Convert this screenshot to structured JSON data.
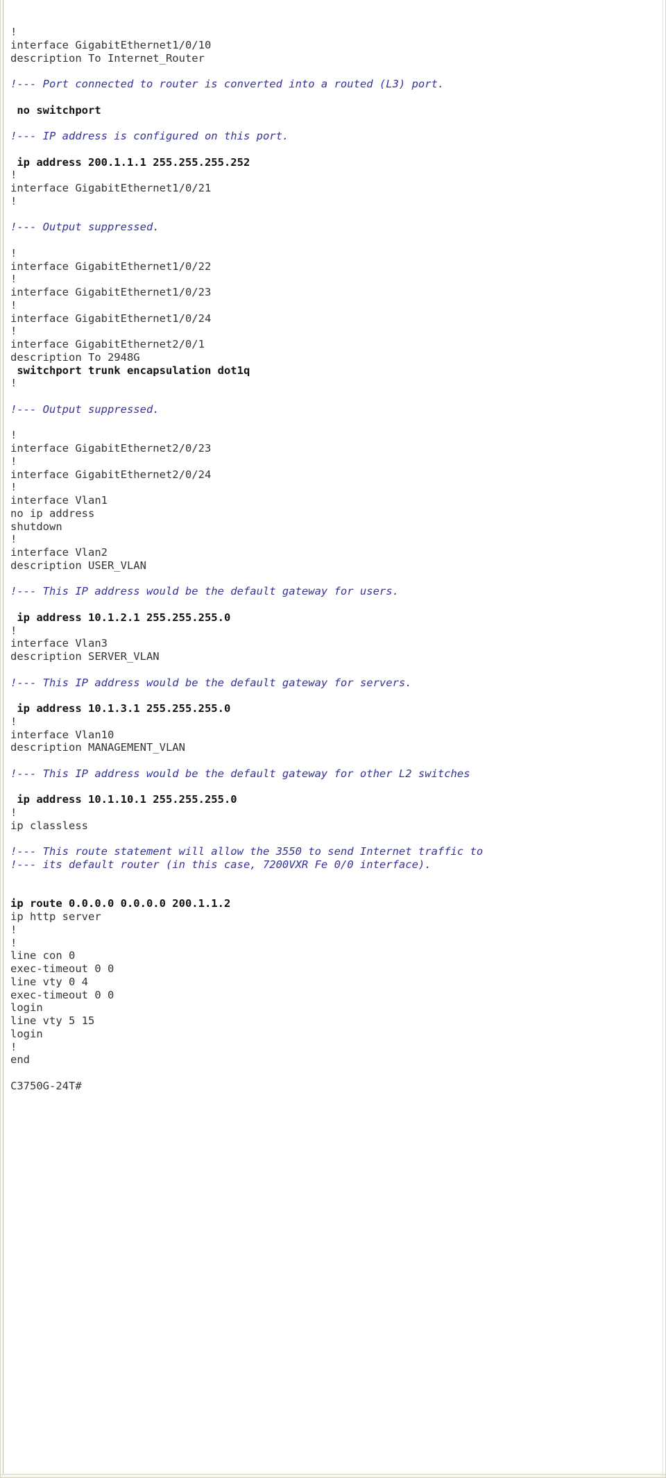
{
  "document": {
    "kind": "cisco-ios-running-config-excerpt",
    "device_prompt": "C3750G-24T#",
    "colors": {
      "plain_text": "#333333",
      "command_text": "#101010",
      "annotation_text": "#333399",
      "page_background": "#ffffff",
      "frame_rule": "#d8d6c8"
    }
  },
  "listing": {
    "lines": [
      {
        "style": "plain",
        "text": "!"
      },
      {
        "style": "plain",
        "text": "interface GigabitEthernet1/0/10"
      },
      {
        "style": "plain",
        "text": "description To Internet_Router"
      },
      {
        "style": "blank",
        "text": ""
      },
      {
        "style": "note",
        "text": "!--- Port connected to router is converted into a routed (L3) port."
      },
      {
        "style": "blank",
        "text": ""
      },
      {
        "style": "cmd",
        "text": " no switchport"
      },
      {
        "style": "blank",
        "text": ""
      },
      {
        "style": "note",
        "text": "!--- IP address is configured on this port."
      },
      {
        "style": "blank",
        "text": ""
      },
      {
        "style": "cmd",
        "text": " ip address 200.1.1.1 255.255.255.252"
      },
      {
        "style": "plain",
        "text": "!"
      },
      {
        "style": "plain",
        "text": "interface GigabitEthernet1/0/21"
      },
      {
        "style": "plain",
        "text": "!"
      },
      {
        "style": "blank",
        "text": ""
      },
      {
        "style": "note",
        "text": "!--- Output suppressed."
      },
      {
        "style": "blank",
        "text": ""
      },
      {
        "style": "plain",
        "text": "!"
      },
      {
        "style": "plain",
        "text": "interface GigabitEthernet1/0/22"
      },
      {
        "style": "plain",
        "text": "!"
      },
      {
        "style": "plain",
        "text": "interface GigabitEthernet1/0/23"
      },
      {
        "style": "plain",
        "text": "!"
      },
      {
        "style": "plain",
        "text": "interface GigabitEthernet1/0/24"
      },
      {
        "style": "plain",
        "text": "!"
      },
      {
        "style": "plain",
        "text": "interface GigabitEthernet2/0/1"
      },
      {
        "style": "plain",
        "text": "description To 2948G"
      },
      {
        "style": "cmd",
        "text": " switchport trunk encapsulation dot1q"
      },
      {
        "style": "plain",
        "text": "!"
      },
      {
        "style": "blank",
        "text": ""
      },
      {
        "style": "note",
        "text": "!--- Output suppressed."
      },
      {
        "style": "blank",
        "text": ""
      },
      {
        "style": "plain",
        "text": "!"
      },
      {
        "style": "plain",
        "text": "interface GigabitEthernet2/0/23"
      },
      {
        "style": "plain",
        "text": "!"
      },
      {
        "style": "plain",
        "text": "interface GigabitEthernet2/0/24"
      },
      {
        "style": "plain",
        "text": "!"
      },
      {
        "style": "plain",
        "text": "interface Vlan1"
      },
      {
        "style": "plain",
        "text": "no ip address"
      },
      {
        "style": "plain",
        "text": "shutdown"
      },
      {
        "style": "plain",
        "text": "!"
      },
      {
        "style": "plain",
        "text": "interface Vlan2"
      },
      {
        "style": "plain",
        "text": "description USER_VLAN"
      },
      {
        "style": "blank",
        "text": ""
      },
      {
        "style": "note",
        "text": "!--- This IP address would be the default gateway for users."
      },
      {
        "style": "blank",
        "text": ""
      },
      {
        "style": "cmd",
        "text": " ip address 10.1.2.1 255.255.255.0"
      },
      {
        "style": "plain",
        "text": "!"
      },
      {
        "style": "plain",
        "text": "interface Vlan3"
      },
      {
        "style": "plain",
        "text": "description SERVER_VLAN"
      },
      {
        "style": "blank",
        "text": ""
      },
      {
        "style": "note",
        "text": "!--- This IP address would be the default gateway for servers."
      },
      {
        "style": "blank",
        "text": ""
      },
      {
        "style": "cmd",
        "text": " ip address 10.1.3.1 255.255.255.0"
      },
      {
        "style": "plain",
        "text": "!"
      },
      {
        "style": "plain",
        "text": "interface Vlan10"
      },
      {
        "style": "plain",
        "text": "description MANAGEMENT_VLAN"
      },
      {
        "style": "blank",
        "text": ""
      },
      {
        "style": "note",
        "text": "!--- This IP address would be the default gateway for other L2 switches"
      },
      {
        "style": "blank",
        "text": ""
      },
      {
        "style": "cmd",
        "text": " ip address 10.1.10.1 255.255.255.0"
      },
      {
        "style": "plain",
        "text": "!"
      },
      {
        "style": "plain",
        "text": "ip classless"
      },
      {
        "style": "blank",
        "text": ""
      },
      {
        "style": "note",
        "text": "!--- This route statement will allow the 3550 to send Internet traffic to"
      },
      {
        "style": "note",
        "text": "!--- its default router (in this case, 7200VXR Fe 0/0 interface)."
      },
      {
        "style": "blank",
        "text": ""
      },
      {
        "style": "blank",
        "text": ""
      },
      {
        "style": "cmd",
        "text": "ip route 0.0.0.0 0.0.0.0 200.1.1.2"
      },
      {
        "style": "plain",
        "text": "ip http server"
      },
      {
        "style": "plain",
        "text": "!"
      },
      {
        "style": "plain",
        "text": "!"
      },
      {
        "style": "plain",
        "text": "line con 0"
      },
      {
        "style": "plain",
        "text": "exec-timeout 0 0"
      },
      {
        "style": "plain",
        "text": "line vty 0 4"
      },
      {
        "style": "plain",
        "text": "exec-timeout 0 0"
      },
      {
        "style": "plain",
        "text": "login"
      },
      {
        "style": "plain",
        "text": "line vty 5 15"
      },
      {
        "style": "plain",
        "text": "login"
      },
      {
        "style": "plain",
        "text": "!"
      },
      {
        "style": "plain",
        "text": "end"
      },
      {
        "style": "blank",
        "text": ""
      },
      {
        "style": "prompt",
        "text": "C3750G-24T#"
      }
    ]
  }
}
